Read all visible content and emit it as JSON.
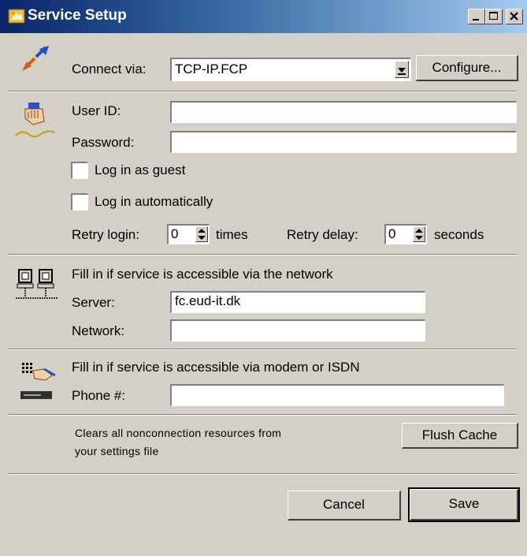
{
  "window": {
    "title": "Service Setup",
    "title_bar_colors": [
      "#0a246a",
      "#a6caf0"
    ],
    "controls": [
      "minimize-icon",
      "maximize-icon",
      "close-icon"
    ]
  },
  "connection": {
    "icon": "connection-arrows-icon",
    "label": "Connect via:",
    "selected": "TCP-IP.FCP",
    "configure_label": "Configure..."
  },
  "login": {
    "icon": "user-hand-icon",
    "user_id_label": "User ID:",
    "user_id_value": "",
    "password_label": "Password:",
    "password_value": "",
    "guest_label": "Log in as guest",
    "guest_checked": false,
    "auto_label": "Log in automatically",
    "auto_checked": false,
    "retry_login_label": "Retry login:",
    "retry_login_value": "0",
    "retry_login_unit": "times",
    "retry_delay_label": "Retry delay:",
    "retry_delay_value": "0",
    "retry_delay_unit": "seconds"
  },
  "network": {
    "icon": "network-computers-icon",
    "hint": "Fill in if service is accessible via the network",
    "server_label": "Server:",
    "server_value": "fc.eud-it.dk",
    "network_label": "Network:",
    "network_value": ""
  },
  "modem": {
    "icon": "modem-phone-icon",
    "hint": "Fill in if service is accessible via modem or ISDN",
    "phone_label": "Phone #:",
    "phone_value": ""
  },
  "cache": {
    "description_line1": "Clears all nonconnection resources from",
    "description_line2": "your settings file",
    "flush_label": "Flush Cache"
  },
  "footer": {
    "cancel_label": "Cancel",
    "save_label": "Save"
  }
}
